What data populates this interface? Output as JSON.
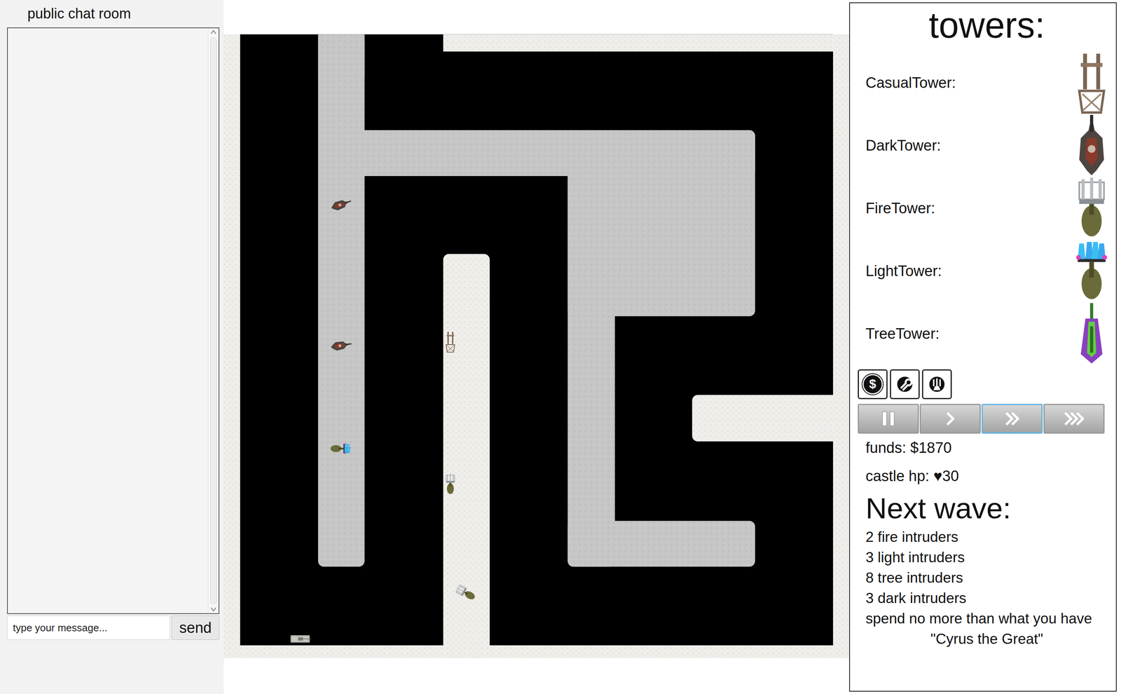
{
  "chat": {
    "title": "public chat room",
    "placeholder": "type your message...",
    "send": "send"
  },
  "map": {
    "units": [
      {
        "kind": "dark"
      },
      {
        "kind": "dark"
      },
      {
        "kind": "light"
      },
      {
        "kind": "casual"
      },
      {
        "kind": "fire"
      },
      {
        "kind": "fire"
      },
      {
        "kind": "tank"
      }
    ]
  },
  "towers_panel": {
    "title": "towers:",
    "towers": [
      {
        "name": "CasualTower:",
        "kind": "casual"
      },
      {
        "name": "DarkTower:",
        "kind": "dark"
      },
      {
        "name": "FireTower:",
        "kind": "fire"
      },
      {
        "name": "LightTower:",
        "kind": "light"
      },
      {
        "name": "TreeTower:",
        "kind": "tree"
      }
    ]
  },
  "tools": [
    {
      "kind": "sell",
      "label": "$",
      "selected": false
    },
    {
      "kind": "repair",
      "selected": false
    },
    {
      "kind": "build",
      "selected": false
    }
  ],
  "speeds": [
    {
      "kind": "pause",
      "selected": false
    },
    {
      "kind": "normal",
      "selected": false
    },
    {
      "kind": "fast",
      "selected": true
    },
    {
      "kind": "fastest",
      "selected": false
    }
  ],
  "funds": "funds: $1870",
  "castle_hp": {
    "label": "castle hp:",
    "icon": "♥",
    "value": "30"
  },
  "next_wave": {
    "title": "Next wave:",
    "items": [
      "2 fire intruders",
      "3 light intruders",
      "8 tree intruders",
      "3 dark intruders"
    ]
  },
  "hint": "spend no more than what you have",
  "quote": "\"Cyrus the Great\""
}
